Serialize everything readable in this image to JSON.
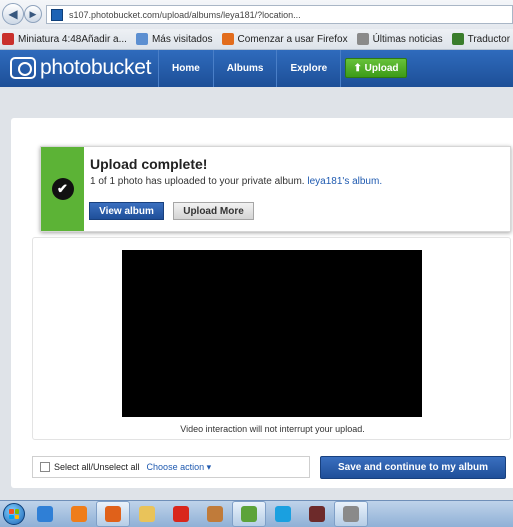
{
  "browser": {
    "url": "s107.photobucket.com/upload/albums/leya181/?location..."
  },
  "bookmarks": [
    {
      "label": "Miniatura 4:48Añadir a...",
      "icon": "bookmark-icon",
      "color": "#c9302c"
    },
    {
      "label": "Más visitados",
      "icon": "page-icon",
      "color": "#5c8fd1"
    },
    {
      "label": "Comenzar a usar Firefox",
      "icon": "firefox-icon",
      "color": "#e26c1c"
    },
    {
      "label": "Últimas noticias",
      "icon": "rss-icon",
      "color": "#8a8a8a"
    },
    {
      "label": "Traductor",
      "icon": "translator-icon",
      "color": "#3a7d2c"
    }
  ],
  "site": {
    "logo": "photobucket",
    "nav": [
      "Home",
      "Albums",
      "Explore"
    ],
    "upload_button": "⬆ Upload"
  },
  "upload_complete": {
    "title": "Upload complete!",
    "message_prefix": "1 of 1 photo has uploaded to your private album.",
    "album_link": "leya181's album.",
    "view_album_button": "View album",
    "upload_more_button": "Upload More"
  },
  "media": {
    "caption": "Video interaction will not interrupt your upload."
  },
  "actions": {
    "select_all_label": "Select all/Unselect all",
    "choose_action": "Choose action ▾",
    "save_button": "Save and continue to my album"
  },
  "taskbar": {
    "items": [
      {
        "icon": "internet-explorer-icon",
        "color": "#2f7fd6",
        "active": false
      },
      {
        "icon": "media-player-icon",
        "color": "#ef7d1a",
        "active": false
      },
      {
        "icon": "firefox-icon",
        "color": "#e0611a",
        "active": true
      },
      {
        "icon": "folder-icon",
        "color": "#e9c35a",
        "active": false
      },
      {
        "icon": "opera-icon",
        "color": "#d9261c",
        "active": false
      },
      {
        "icon": "paint-icon",
        "color": "#c07b3a",
        "active": false
      },
      {
        "icon": "image-app-icon",
        "color": "#5ca33a",
        "active": true
      },
      {
        "icon": "skype-icon",
        "color": "#1aa0e0",
        "active": false
      },
      {
        "icon": "game-icon",
        "color": "#6d2a2a",
        "active": false
      },
      {
        "icon": "tools-icon",
        "color": "#8a8a8a",
        "active": true
      }
    ]
  }
}
